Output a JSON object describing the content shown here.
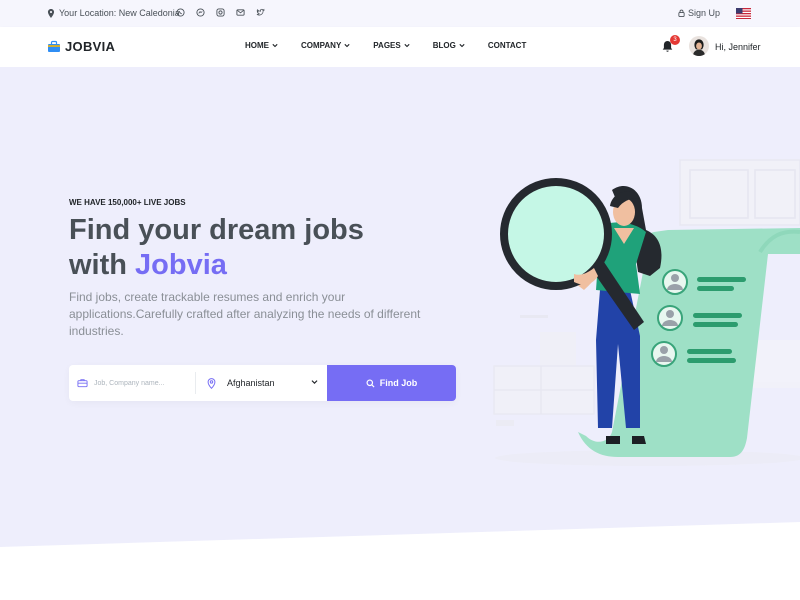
{
  "topbar": {
    "location_text": "Your Location: New Caledonia",
    "social_icons": [
      "whatsapp-icon",
      "messenger-icon",
      "instagram-icon",
      "mail-icon",
      "twitter-icon"
    ],
    "signup_label": "Sign Up",
    "language_flag": "us-flag-icon"
  },
  "nav": {
    "logo_text": "JOBVIA",
    "menu": [
      {
        "label": "HOME",
        "has_dropdown": true
      },
      {
        "label": "COMPANY",
        "has_dropdown": true
      },
      {
        "label": "PAGES",
        "has_dropdown": true
      },
      {
        "label": "BLOG",
        "has_dropdown": true
      },
      {
        "label": "CONTACT",
        "has_dropdown": false
      }
    ],
    "notification_count": "3",
    "greeting": "Hi, Jennifer"
  },
  "hero": {
    "eyebrow": "WE HAVE 150,000+ LIVE JOBS",
    "title_line1": "Find your dream jobs",
    "title_prefix": "with ",
    "title_brand": "Jobvia",
    "description": "Find jobs, create trackable resumes and enrich your applications.Carefully crafted after analyzing the needs of different industries."
  },
  "search": {
    "keyword_placeholder": "Job, Company name...",
    "location_value": "Afghanistan",
    "button_label": "Find Job"
  },
  "colors": {
    "accent": "#766df4",
    "hero_bg": "#eeeefc",
    "topbar_bg": "#f6f6fd",
    "illustration_green": "#9ee0c6",
    "badge_red": "#e53935"
  }
}
